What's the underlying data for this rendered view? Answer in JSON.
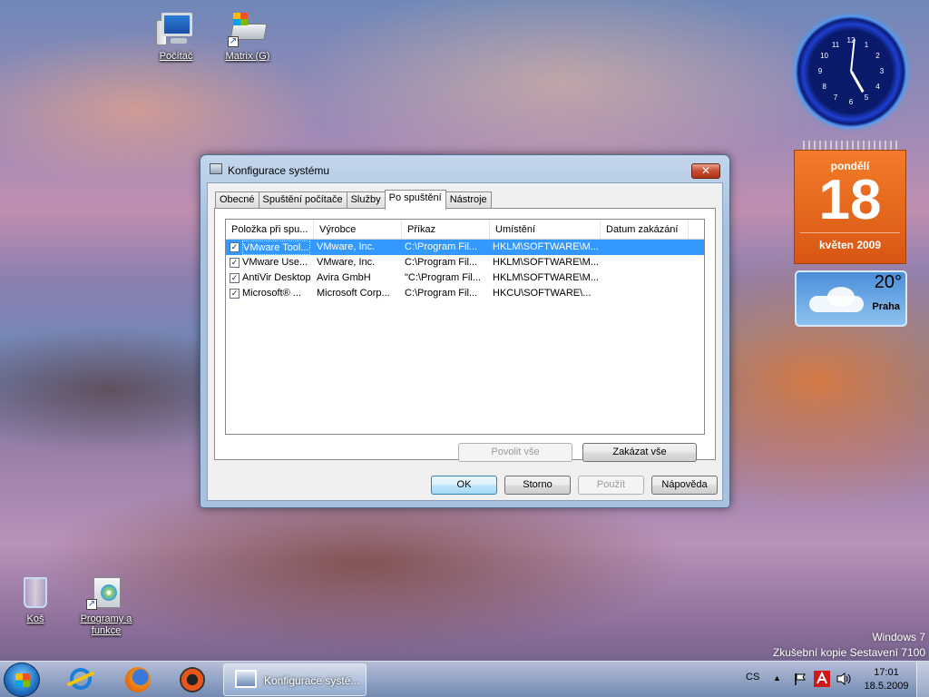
{
  "desktop": {
    "icons": {
      "computer": "Počítač",
      "matrix": "Matrix (G)",
      "recycle_bin": "Koš",
      "programs": "Programy a funkce"
    },
    "watermark": {
      "line1": "Windows 7",
      "line2": "Zkušební kopie Sestavení 7100"
    }
  },
  "gadgets": {
    "clock": {
      "numbers": [
        "12",
        "1",
        "2",
        "3",
        "4",
        "5",
        "6",
        "7",
        "8",
        "9",
        "10",
        "11"
      ]
    },
    "calendar": {
      "day_name": "pondělí",
      "day": "18",
      "month_year": "květen 2009",
      "accent_color": "#e0641a"
    },
    "weather": {
      "temperature": "20°",
      "city": "Praha"
    }
  },
  "dialog": {
    "title": "Konfigurace systému",
    "close_label": "✕",
    "tabs": [
      {
        "label": "Obecné"
      },
      {
        "label": "Spuštění počítače"
      },
      {
        "label": "Služby"
      },
      {
        "label": "Po spuštění"
      },
      {
        "label": "Nástroje"
      }
    ],
    "active_tab": "Po spuštění",
    "columns": [
      "Položka při spu...",
      "Výrobce",
      "Příkaz",
      "Umístění",
      "Datum zakázání"
    ],
    "rows": [
      {
        "checked": true,
        "item": "VMware Tool...",
        "vendor": "VMware, Inc.",
        "command": "C:\\Program Fil...",
        "location": "HKLM\\SOFTWARE\\M...",
        "date": ""
      },
      {
        "checked": true,
        "item": "VMware Use...",
        "vendor": "VMware, Inc.",
        "command": "C:\\Program Fil...",
        "location": "HKLM\\SOFTWARE\\M...",
        "date": ""
      },
      {
        "checked": true,
        "item": "AntiVir Desktop",
        "vendor": "Avira GmbH",
        "command": "\"C:\\Program Fil...",
        "location": "HKLM\\SOFTWARE\\M...",
        "date": ""
      },
      {
        "checked": true,
        "item": "Microsoft® ...",
        "vendor": "Microsoft Corp...",
        "command": "C:\\Program Fil...",
        "location": "HKCU\\SOFTWARE\\...",
        "date": ""
      }
    ],
    "selection_color": "#3399ff",
    "buttons": {
      "enable_all": "Povolit vše",
      "disable_all": "Zakázat vše",
      "ok": "OK",
      "cancel": "Storno",
      "apply": "Použít",
      "help": "Nápověda"
    }
  },
  "taskbar": {
    "task_label": "Konfigurace systé...",
    "language": "CS",
    "time": "17:01",
    "date": "18.5.2009",
    "tray_arrow": "▲"
  }
}
